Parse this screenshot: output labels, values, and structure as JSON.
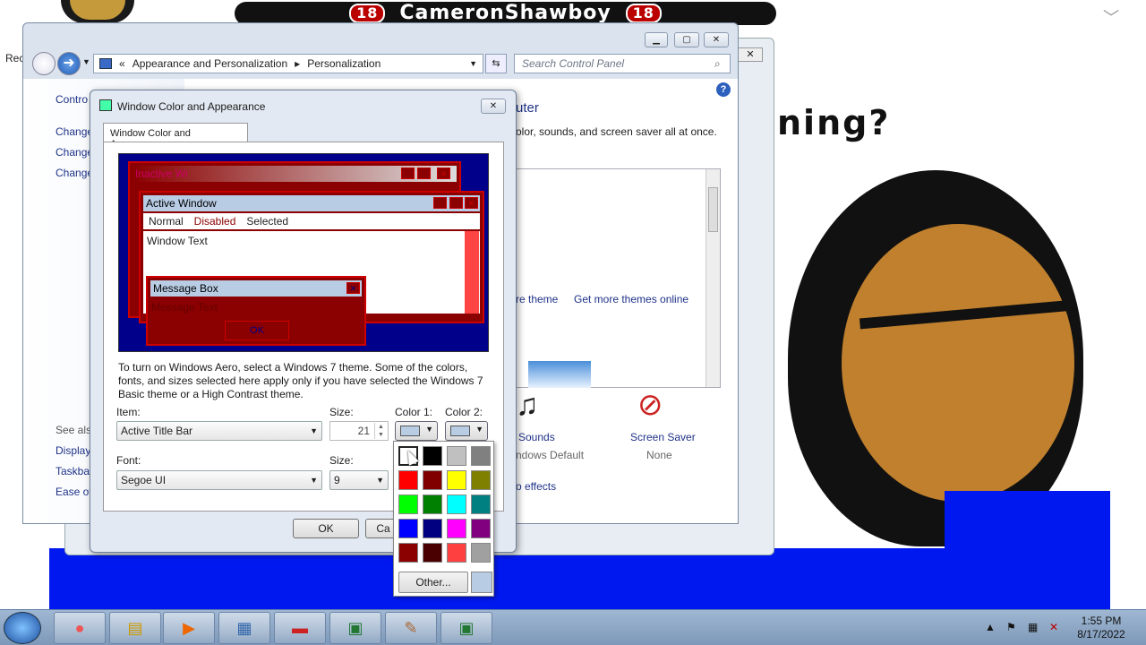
{
  "desktop": {
    "banner_left": "18",
    "banner_name": "CameronShawboy",
    "banner_right": "18",
    "question_text": "ning?",
    "recycle_label": "Rec"
  },
  "cp": {
    "breadcrumb_prefix": "«",
    "breadcrumb_1": "Appearance and Personalization",
    "breadcrumb_sep": "▸",
    "breadcrumb_2": "Personalization",
    "search_placeholder": "Search Control Panel",
    "left_items": [
      "Contro",
      "Change",
      "Change",
      "Change"
    ],
    "see_also_items": [
      "See also",
      "Display",
      "Taskba",
      "Ease of"
    ],
    "heading_suffix": "uter",
    "subheading": "olor, sounds, and screen saver all at once.",
    "save_theme": "re theme",
    "more_themes": "Get more themes online",
    "sounds_label": "Sounds",
    "sounds_value": "ndows Default",
    "screensaver_label": "Screen Saver",
    "screensaver_value": "None",
    "effects_link": "o effects"
  },
  "dialog": {
    "title": "Window Color and Appearance",
    "tab": "Window Color and Appearance",
    "preview": {
      "inactive_title": "Inactive Wi",
      "active_title": "Active Window",
      "menu_normal": "Normal",
      "menu_disabled": "Disabled",
      "menu_selected": "Selected",
      "window_text": "Window Text",
      "msgbox_title": "Message Box",
      "msgbox_text": "Message Text",
      "msgbox_ok": "OK"
    },
    "info": "To turn on Windows Aero, select a Windows 7 theme.  Some of the colors, fonts, and sizes selected here apply only if you have selected the Windows 7 Basic theme or a High Contrast theme.",
    "item_label": "Item:",
    "item_value": "Active Title Bar",
    "size_label": "Size:",
    "size_value": "21",
    "color1_label": "Color 1:",
    "color2_label": "Color 2:",
    "font_label": "Font:",
    "font_value": "Segoe UI",
    "font_size_label": "Size:",
    "font_size_value": "9",
    "ok": "OK",
    "cancel": "Ca"
  },
  "palette": {
    "colors": [
      "#ffffff",
      "#000000",
      "#c0c0c0",
      "#808080",
      "#ff0000",
      "#800000",
      "#ffff00",
      "#808000",
      "#00ff00",
      "#008000",
      "#00ffff",
      "#008080",
      "#0000ff",
      "#000080",
      "#ff00ff",
      "#800080",
      "#8b0000",
      "#4a0000",
      "#ff4040",
      "#a0a0a0"
    ],
    "other_label": "Other...",
    "current_color": "#b8cce4"
  },
  "taskbar": {
    "time": "1:55 PM",
    "date": "8/17/2022"
  }
}
